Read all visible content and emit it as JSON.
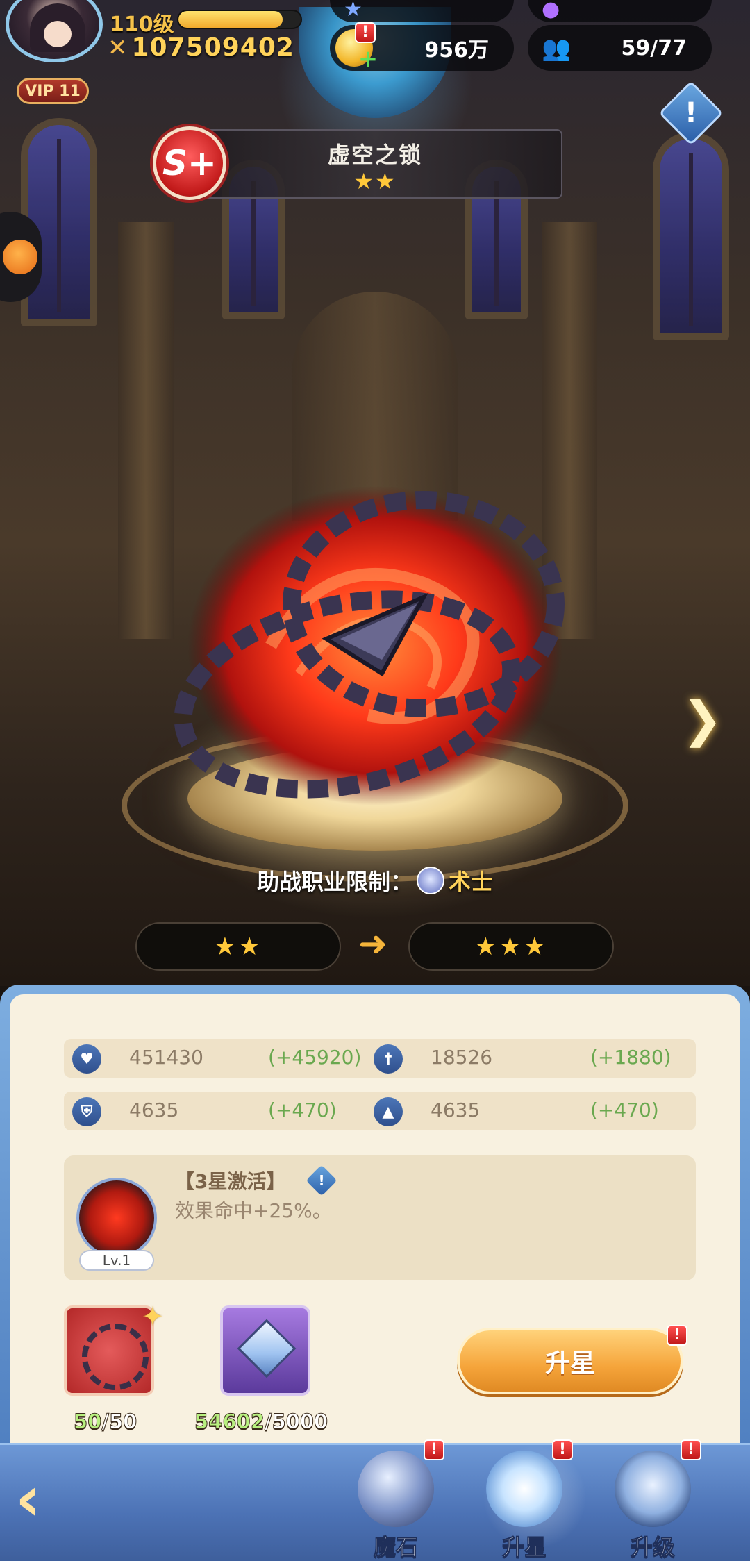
{
  "hud": {
    "level": "110级",
    "exp_progress": 0.85,
    "power": "107509402",
    "vip": "VIP 11",
    "coins": "956万",
    "friends": "59/77",
    "alert": "!"
  },
  "item": {
    "name": "虚空之锁",
    "rank": "S+",
    "current_stars": "★★",
    "next_stars": "★★★",
    "class_limit_label": "助战职业限制：",
    "class_name": "术士"
  },
  "stats": [
    {
      "icon": "heart-icon",
      "value": "451430",
      "add": "(+45920)"
    },
    {
      "icon": "sword-icon",
      "value": "18526",
      "add": "(+1880)"
    },
    {
      "icon": "shield-icon",
      "value": "4635",
      "add": "(+470)"
    },
    {
      "icon": "mage-hat-icon",
      "value": "4635",
      "add": "(+470)"
    }
  ],
  "skill": {
    "title": "【3星激活】",
    "desc": "效果命中+25%。",
    "level": "Lv.1"
  },
  "materials": {
    "shard_have": "50",
    "shard_need": "/50",
    "crystal_have": "54602",
    "crystal_need": "/5000"
  },
  "actions": {
    "upgrade_label": "升星"
  },
  "nav": {
    "tabs": [
      {
        "label": "魔石"
      },
      {
        "label": "升星"
      },
      {
        "label": "升级"
      }
    ]
  },
  "colors": {
    "accent_gold": "#ffd35a",
    "stat_add_green": "#6aa84f",
    "nav_blue": "#4c72b5"
  }
}
